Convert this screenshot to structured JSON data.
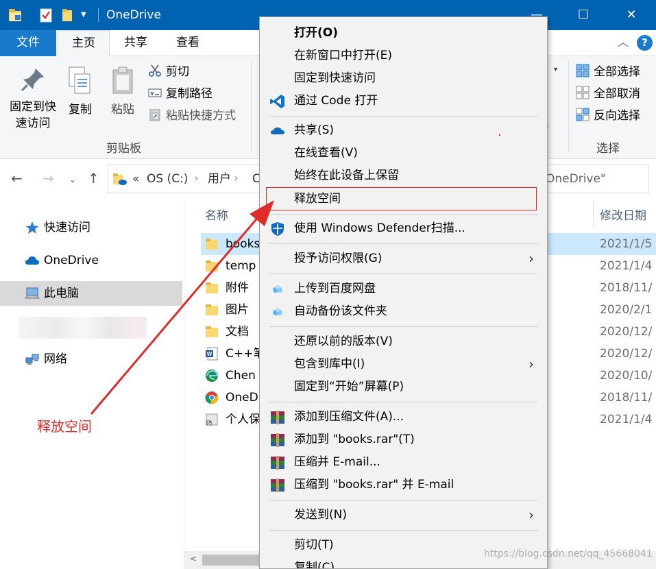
{
  "window": {
    "title": "OneDrive",
    "controls": {
      "minimize": "—",
      "maximize": "☐",
      "close": "✕"
    }
  },
  "ribbon_tabs": {
    "file": "文件",
    "home": "主页",
    "share": "共享",
    "view": "查看",
    "collapse": "︿",
    "help": "?"
  },
  "ribbon": {
    "pin_line1": "固定到快",
    "pin_line2": "速访问",
    "copy": "复制",
    "paste": "粘贴",
    "cut": "剪切",
    "copy_path": "复制路径",
    "paste_shortcut": "粘贴快捷方式",
    "clipboard_group": "剪贴板",
    "select_all": "全部选择",
    "select_none": "全部取消",
    "invert_selection": "反向选择",
    "select_group": "选择",
    "dropdown": "▾"
  },
  "navigation": {
    "back": "←",
    "forward": "→",
    "history": "⌄",
    "up": "↑",
    "address": {
      "chevron": "«",
      "crumbs": [
        "OS (C:)",
        "用户",
        "C"
      ],
      "separator": "›",
      "search_placeholder": "OneDrive\""
    }
  },
  "nav_pane": {
    "items": [
      {
        "label": "快速访问",
        "icon": "star-icon"
      },
      {
        "label": "OneDrive",
        "icon": "cloud-icon"
      },
      {
        "label": "此电脑",
        "icon": "computer-icon",
        "selected": true
      },
      {
        "label": "网络",
        "icon": "network-icon"
      }
    ]
  },
  "file_list": {
    "columns": {
      "name": "名称",
      "date": "修改日期"
    },
    "rows": [
      {
        "name": "books",
        "date": "2021/1/5",
        "icon": "folder-icon",
        "selected": true
      },
      {
        "name": "temp",
        "date": "2021/1/4",
        "icon": "folder-icon"
      },
      {
        "name": "附件",
        "date": "2018/11/",
        "icon": "folder-icon"
      },
      {
        "name": "图片",
        "date": "2020/2/1",
        "icon": "folder-icon"
      },
      {
        "name": "文档",
        "date": "2020/12/",
        "icon": "folder-icon"
      },
      {
        "name": "C++笔",
        "date": "2020/12/",
        "icon": "word-icon"
      },
      {
        "name": "Chen",
        "date": "2020/10/",
        "icon": "edge-icon"
      },
      {
        "name": "OneD",
        "date": "2018/11/",
        "icon": "chrome-icon"
      },
      {
        "name": "个人保",
        "date": "2021/1/4",
        "icon": "shortcut-icon"
      }
    ],
    "scroll_left": "<"
  },
  "context_menu": {
    "items": [
      {
        "label": "打开(O)",
        "bold": true
      },
      {
        "label": "在新窗口中打开(E)"
      },
      {
        "label": "固定到快速访问"
      },
      {
        "label": "通过 Code 打开",
        "icon": "vscode-icon"
      },
      {
        "label": "共享(S)",
        "icon": "onedrive-icon"
      },
      {
        "label": "在线查看(V)"
      },
      {
        "label": "始终在此设备上保留"
      },
      {
        "label": "释放空间",
        "highlighted": true
      },
      {
        "label": "使用 Windows Defender扫描...",
        "icon": "defender-icon"
      },
      {
        "label": "授予访问权限(G)",
        "submenu": true
      },
      {
        "label": "上传到百度网盘",
        "icon": "baidu-icon"
      },
      {
        "label": "自动备份该文件夹",
        "icon": "baidu-icon"
      },
      {
        "label": "还原以前的版本(V)"
      },
      {
        "label": "包含到库中(I)",
        "submenu": true
      },
      {
        "label": "固定到“开始”屏幕(P)"
      },
      {
        "label": "添加到压缩文件(A)...",
        "icon": "winrar-icon"
      },
      {
        "label": "添加到 \"books.rar\"(T)",
        "icon": "winrar-icon"
      },
      {
        "label": "压缩并 E-mail...",
        "icon": "winrar-icon"
      },
      {
        "label": "压缩到 \"books.rar\" 并 E-mail",
        "icon": "winrar-icon"
      },
      {
        "label": "发送到(N)",
        "submenu": true
      },
      {
        "label": "剪切(T)"
      },
      {
        "label": "复制(C)"
      }
    ],
    "submenu_arrow": "›"
  },
  "annotation": {
    "text": "释放空间",
    "color": "#e02b2b"
  },
  "watermark": "https://blog.csdn.net/qq_45668041",
  "colors": {
    "titlebar": "#0063b1",
    "file_tab": "#1979ca",
    "selection": "#cce8ff",
    "accent_red": "#e02b2b"
  }
}
